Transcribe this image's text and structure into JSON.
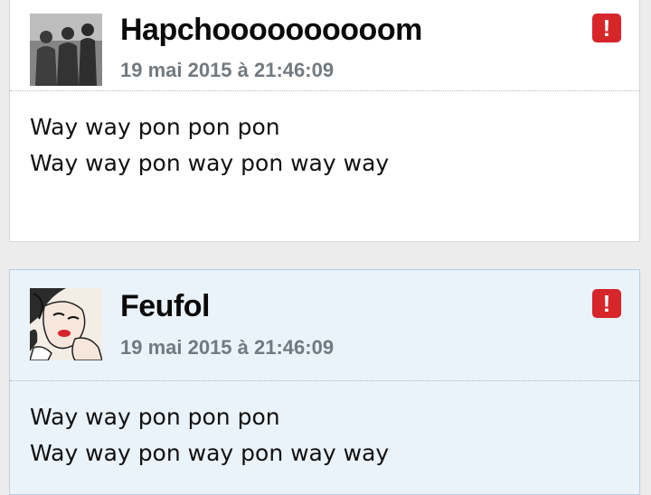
{
  "posts": [
    {
      "author": "Hapchoooooooooom",
      "date": "19 mai 2015 à 21:46:09",
      "alert_icon": "!",
      "body_lines": [
        "Way way pon pon pon",
        "Way way pon way pon way way"
      ],
      "avatar": "grayscale-group-photo",
      "highlighted": false
    },
    {
      "author": "Feufol",
      "date": "19 mai 2015 à 21:46:09",
      "alert_icon": "!",
      "body_lines": [
        "Way way pon pon pon",
        "Way way pon way pon way way"
      ],
      "avatar": "pop-art-woman-drawing",
      "highlighted": true
    }
  ],
  "colors": {
    "alert": "#d6262a",
    "highlight_bg": "#eaf2fa",
    "date_text": "#727a80",
    "page_bg": "#ececec"
  }
}
